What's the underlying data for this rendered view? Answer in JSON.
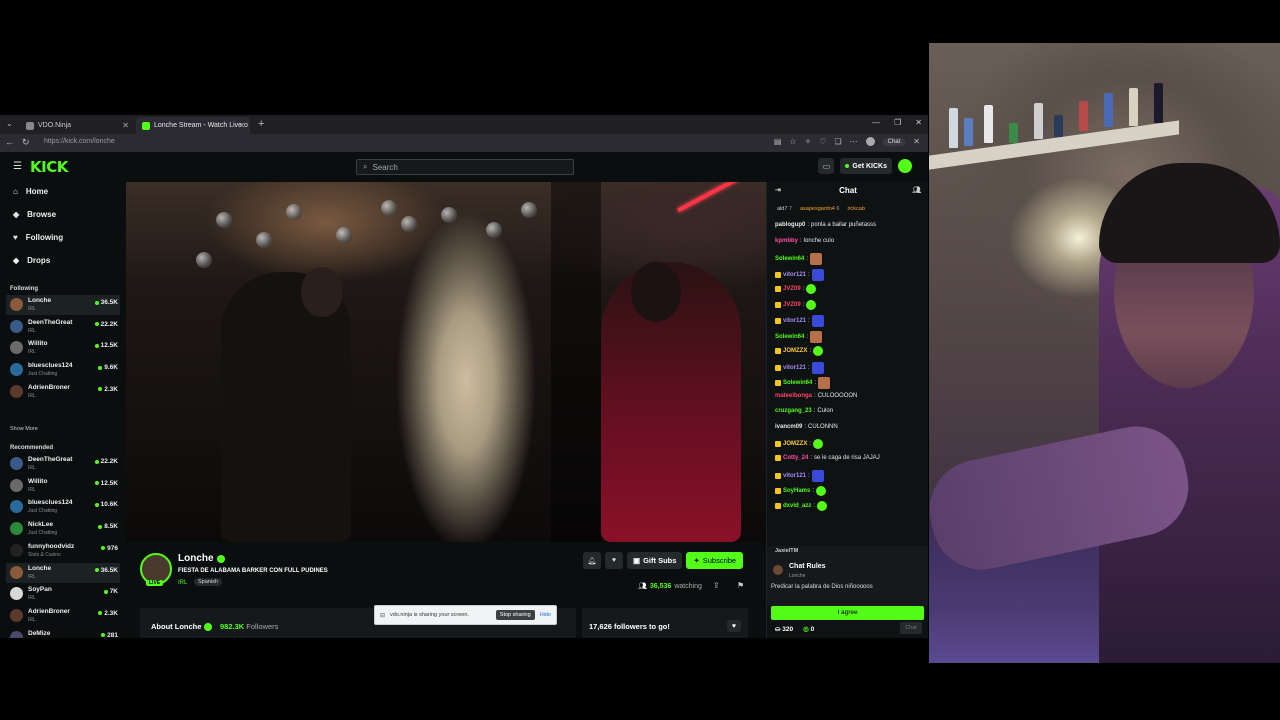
{
  "browser": {
    "tabs": [
      {
        "label": "VDO.Ninja",
        "active": false
      },
      {
        "label": "Lonche Stream - Watch Live o",
        "active": true
      }
    ],
    "new_tab": "+",
    "url": "https://kick.com/lonche",
    "profile_label": "Chat",
    "window_controls": [
      "—",
      "❐",
      "✕"
    ]
  },
  "kick": {
    "logo": "KICK",
    "search_placeholder": "Search",
    "get_kicks_label": "Get KICKs"
  },
  "sidebar": {
    "main_nav": [
      {
        "label": "Home",
        "icon": "home-icon",
        "glyph": "⌂"
      },
      {
        "label": "Browse",
        "icon": "browse-icon",
        "glyph": "◈"
      },
      {
        "label": "Following",
        "icon": "heart-icon",
        "glyph": "♥"
      },
      {
        "label": "Drops",
        "icon": "drops-icon",
        "glyph": "◆"
      }
    ],
    "following_header": "Following",
    "following": [
      {
        "name": "Lonche",
        "category": "IRL",
        "viewers": "36.5K",
        "selected": true,
        "color": "#8a5a3a"
      },
      {
        "name": "DeenTheGreat",
        "category": "IRL",
        "viewers": "22.2K",
        "color": "#3a5a8a"
      },
      {
        "name": "Willito",
        "category": "IRL",
        "viewers": "12.5K",
        "color": "#6a6a6a"
      },
      {
        "name": "bluesclues124",
        "category": "Just Chatting",
        "viewers": "9.6K",
        "color": "#2a6a9a"
      },
      {
        "name": "AdrienBroner",
        "category": "IRL",
        "viewers": "2.3K",
        "color": "#5a3a2a"
      }
    ],
    "show_more": "Show More",
    "recommended_header": "Recommended",
    "recommended": [
      {
        "name": "DeenTheGreat",
        "category": "IRL",
        "viewers": "22.2K",
        "color": "#3a5a8a"
      },
      {
        "name": "Willito",
        "category": "IRL",
        "viewers": "12.5K",
        "color": "#6a6a6a"
      },
      {
        "name": "bluesclues124",
        "category": "Just Chatting",
        "viewers": "10.6K",
        "color": "#2a6a9a"
      },
      {
        "name": "NickLee",
        "category": "Just Chatting",
        "viewers": "8.5K",
        "color": "#2a8a3a"
      },
      {
        "name": "funnyhoodvidz",
        "category": "Slots & Casino",
        "viewers": "976",
        "color": "#222222"
      },
      {
        "name": "Lonche",
        "category": "IRL",
        "viewers": "36.5K",
        "selected": true,
        "color": "#8a5a3a"
      },
      {
        "name": "SoyPan",
        "category": "IRL",
        "viewers": "7K",
        "color": "#d8d8d8"
      },
      {
        "name": "AdrienBroner",
        "category": "IRL",
        "viewers": "2.3K",
        "color": "#5a3a2a"
      },
      {
        "name": "DeMize",
        "category": "Slots & Casino",
        "viewers": "281",
        "color": "#4a4a6a"
      }
    ]
  },
  "stream": {
    "streamer": "Lonche",
    "title": "FIESTA DE ALABAMA BARKER CON FULL PUDINES",
    "category": "IRL",
    "language": "Spanish",
    "live_badge": "LIVE",
    "gift_subs": "Gift Subs",
    "subscribe": "Subscribe",
    "viewers": "36,536",
    "viewers_label": "watching",
    "about": "About Lonche",
    "followers_count": "982.3K",
    "followers_label": "Followers",
    "goal_text": "17,626 followers to go!"
  },
  "share_notification": {
    "message": "vdo.ninja is sharing your screen.",
    "stop": "Stop sharing",
    "hide": "Hide"
  },
  "chat": {
    "title": "Chat",
    "pinned": [
      {
        "name": "ald7",
        "value": "7",
        "color": "#cccccc"
      },
      {
        "name": "asapesgardo4",
        "value": "6",
        "color": "#f5a623"
      },
      {
        "name": "rickcab",
        "value": "",
        "color": "#f5a623"
      }
    ],
    "messages": [
      {
        "user": "pablogup0",
        "color": "#e6e6e6",
        "text": "ponla a bailar puñetasss"
      },
      {
        "user": "kpmbby",
        "color": "#ff4da6",
        "text": "lonche culo"
      },
      {
        "user": "Solewin64",
        "color": "#53fc18",
        "text": "",
        "emote": "#b5704a",
        "badge": false
      },
      {
        "user": "vitor121",
        "color": "#a78bfa",
        "text": "",
        "emote": "#3a4ad8",
        "badge": true
      },
      {
        "user": "JVZ09",
        "color": "#ff4466",
        "text": "",
        "emote": "#53fc18",
        "emote_round": true,
        "badge": true
      },
      {
        "user": "JVZ09",
        "color": "#ff4466",
        "text": "",
        "emote": "#53fc18",
        "emote_round": true,
        "badge": true
      },
      {
        "user": "vitor121",
        "color": "#a78bfa",
        "text": "",
        "emote": "#3a4ad8",
        "badge": true
      },
      {
        "user": "Solewin64",
        "color": "#53fc18",
        "text": "",
        "emote": "#b5704a",
        "badge": false
      },
      {
        "user": "JOMZZX",
        "color": "#ffcc33",
        "text": "",
        "emote": "#53fc18",
        "emote_round": true,
        "badge": true
      },
      {
        "user": "vitor121",
        "color": "#a78bfa",
        "text": "",
        "emote": "#3a4ad8",
        "badge": true
      },
      {
        "user": "Solewin64",
        "color": "#53fc18",
        "text": "",
        "emote": "#b5704a",
        "badge": true
      },
      {
        "user": "mateelbonga",
        "color": "#ff4466",
        "text": "CULOOOOON"
      },
      {
        "user": "cruzgang_23",
        "color": "#53fc18",
        "text": "Culon"
      },
      {
        "user": "ivancm09",
        "color": "#e6e6e6",
        "text": "CULONNN"
      },
      {
        "user": "JOMZZX",
        "color": "#ffcc33",
        "text": "",
        "emote": "#53fc18",
        "emote_round": true,
        "badge": true
      },
      {
        "user": "Cotty_24",
        "color": "#ff4da6",
        "text": "se le caga de risa JAJAJ",
        "badge": true
      },
      {
        "user": "vitor121",
        "color": "#a78bfa",
        "text": "",
        "emote": "#3a4ad8",
        "badge": true
      },
      {
        "user": "SoyHams",
        "color": "#53fc18",
        "text": "",
        "emote": "#53fc18",
        "emote_round": true,
        "badge": true
      },
      {
        "user": "dxvid_azz",
        "color": "#53fc18",
        "text": "",
        "emote": "#53fc18",
        "emote_round": true,
        "badge": true
      }
    ],
    "rules_sender": "JaxielTM",
    "rules_title": "Chat Rules",
    "rules_owner": "Lonche",
    "rules_text": "Predicar la palabra de Dios niñooooos",
    "agree": "I agree",
    "kicks_count": "320",
    "points": "0",
    "send": "Chat"
  }
}
